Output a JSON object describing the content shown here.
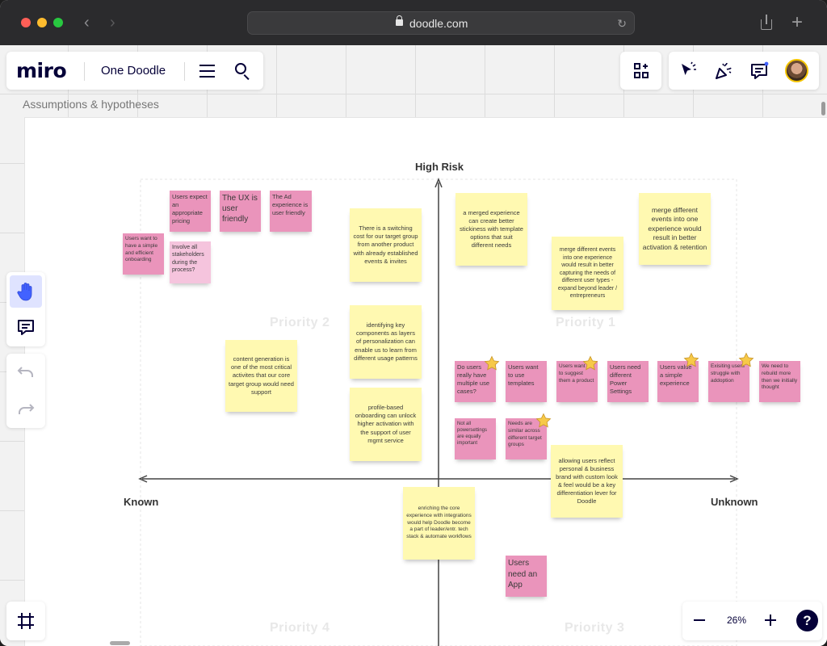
{
  "browser": {
    "url": "doodle.com"
  },
  "app": {
    "logo": "miro",
    "board_name": "One Doodle"
  },
  "frame": {
    "title": "Assumptions & hypotheses"
  },
  "matrix": {
    "y_top": "High Risk",
    "x_left": "Known",
    "x_right": "Unknown",
    "quadrants": [
      "Priority 1",
      "Priority 2",
      "Priority 3",
      "Priority 4"
    ]
  },
  "stickies": [
    {
      "color": "pink",
      "text": "Users expect an appropriate pricing"
    },
    {
      "color": "pink",
      "text": "The UX is user friendly"
    },
    {
      "color": "pink",
      "text": "The Ad experience is user friendly"
    },
    {
      "color": "pink",
      "text": "Users want to have a simple and efficient onboarding"
    },
    {
      "color": "light-pink",
      "text": "Involve all stakeholders during the process?"
    },
    {
      "color": "yellow",
      "text": "There is a switching cost for our target group from another product with already established events & invites"
    },
    {
      "color": "yellow",
      "text": "identifying key components as layers of personalization can enable us to learn from different usage patterns"
    },
    {
      "color": "yellow",
      "text": "profile-based onboarding can unlock higher activation with the support of user mgmt service"
    },
    {
      "color": "yellow",
      "text": "content generation is one of the most critical activites that our core target group would need support"
    },
    {
      "color": "yellow",
      "text": "a merged experience can create better stickiness with template options that suit different needs"
    },
    {
      "color": "yellow",
      "text": "merge different events into one experience would result in better capturing the needs of different user types - expand beyond leader / entrepreneurs"
    },
    {
      "color": "yellow",
      "text": "merge different events into one experience would result in better activation & retention"
    },
    {
      "color": "pink",
      "text": "Do users really have multiple use cases?"
    },
    {
      "color": "pink",
      "text": "Users want to use templates"
    },
    {
      "color": "pink",
      "text": "Users want us to suggest them a product"
    },
    {
      "color": "pink",
      "text": "Users need different Power Settings"
    },
    {
      "color": "pink",
      "text": "Users value a simple experience"
    },
    {
      "color": "pink",
      "text": "Exisiting users struggle with addoption"
    },
    {
      "color": "pink",
      "text": "We need to rebuild more then we initially thought"
    },
    {
      "color": "pink",
      "text": "Not all powersettings are equally important"
    },
    {
      "color": "pink",
      "text": "Needs are similar across different target groups"
    },
    {
      "color": "yellow",
      "text": "allowing users reflect personal & business brand with custom look & feel would be a key differentiation lever for Doodle"
    },
    {
      "color": "yellow",
      "text": "enriching the core experience with integrations would help Doodle become a part of leader/entr. tech stack & automate workflows"
    },
    {
      "color": "pink",
      "text": "Users need an App"
    }
  ],
  "zoom": {
    "level": "26%",
    "help": "?"
  },
  "icons": {
    "apps": "apps-icon",
    "cursor": "select-cursor-icon",
    "celebrate": "confetti-icon",
    "comments": "comment-icon",
    "hand": "hand-icon",
    "undo": "undo-icon",
    "redo": "redo-icon",
    "frames": "frames-icon"
  }
}
